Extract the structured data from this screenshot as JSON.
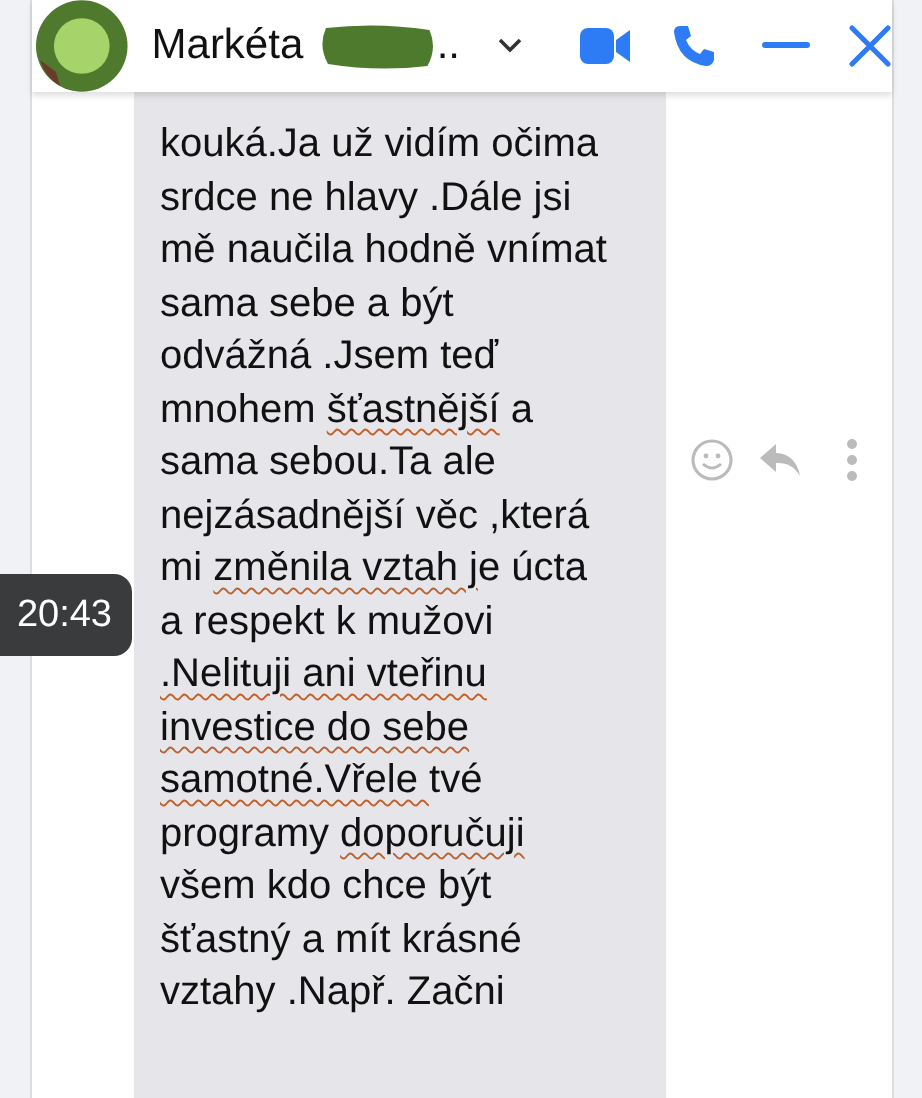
{
  "header": {
    "name": "Markéta",
    "name_tail": ".."
  },
  "message": {
    "lines": [
      [
        {
          "text": "kouká.Ja už vidím očima",
          "misspelled": false
        }
      ],
      [
        {
          "text": "srdce ne hlavy .Dále jsi",
          "misspelled": false
        }
      ],
      [
        {
          "text": "mě naučila hodně vnímat",
          "misspelled": false
        }
      ],
      [
        {
          "text": "sama sebe a být",
          "misspelled": false
        }
      ],
      [
        {
          "text": "odvážná .Jsem teď",
          "misspelled": false
        }
      ],
      [
        {
          "text": "mnohem ",
          "misspelled": false
        },
        {
          "text": "šťastnější",
          "misspelled": true
        },
        {
          "text": " a",
          "misspelled": false
        }
      ],
      [
        {
          "text": "sama sebou.Ta ale",
          "misspelled": false
        }
      ],
      [
        {
          "text": "nejzásadnější věc ,která",
          "misspelled": false
        }
      ],
      [
        {
          "text": "mi ",
          "misspelled": false
        },
        {
          "text": "změnila vztah j",
          "misspelled": true
        },
        {
          "text": "e úcta",
          "misspelled": false
        }
      ],
      [
        {
          "text": "a respekt k mužovi",
          "misspelled": false
        }
      ],
      [
        {
          "text": ".Nelituji ani vteřinu",
          "misspelled": true
        }
      ],
      [
        {
          "text": "investice do sebe",
          "misspelled": true
        }
      ],
      [
        {
          "text": "samotné.Vřele ",
          "misspelled": true
        },
        {
          "text": "tvé",
          "misspelled": false
        }
      ],
      [
        {
          "text": "programy ",
          "misspelled": false
        },
        {
          "text": "doporučuji",
          "misspelled": true
        }
      ],
      [
        {
          "text": "všem kdo chce být",
          "misspelled": false
        }
      ],
      [
        {
          "text": "šťastný a mít krásné",
          "misspelled": false
        }
      ],
      [
        {
          "text": "vztahy .Např. Začni",
          "misspelled": false
        }
      ]
    ]
  },
  "timestamp": "20:43"
}
